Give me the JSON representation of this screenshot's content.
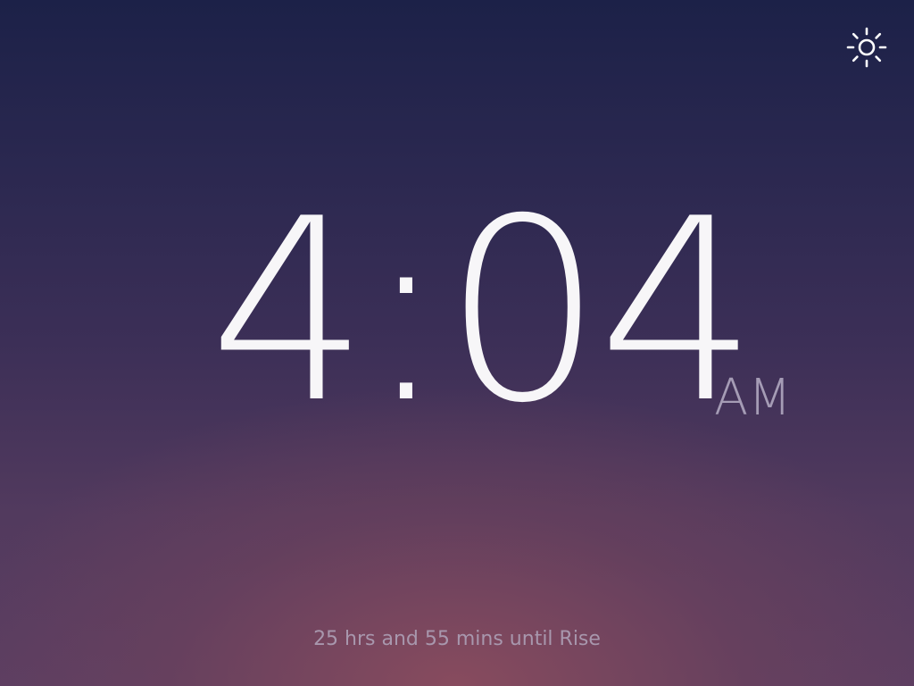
{
  "clock": {
    "time": "4:04",
    "meridiem": "AM"
  },
  "countdown": {
    "text": "25 hrs and 55 mins until Rise"
  },
  "settings": {
    "icon": "brightness-icon"
  },
  "colors": {
    "background_top": "#1c2148",
    "background_bottom_glow": "#8a4c5e",
    "time_text": "#f7f6f8",
    "meridiem_text": "#a59cb5",
    "countdown_text": "#a897ad"
  }
}
